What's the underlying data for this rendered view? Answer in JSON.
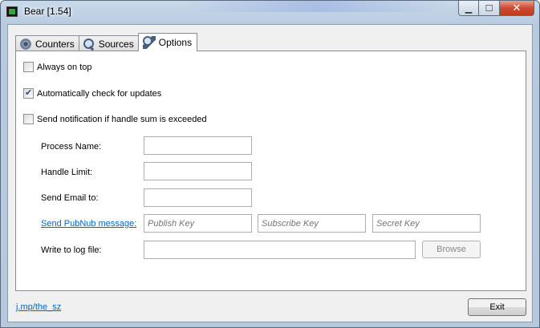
{
  "window": {
    "title": "Bear [1.54]",
    "controls": {
      "minimize": "▁",
      "maximize": "☐",
      "close": "✕"
    }
  },
  "tabs": [
    {
      "label": "Counters",
      "icon": "gear-icon",
      "active": false
    },
    {
      "label": "Sources",
      "icon": "magnifier-icon",
      "active": false
    },
    {
      "label": "Options",
      "icon": "wrench-icon",
      "active": true
    }
  ],
  "options": {
    "always_on_top": {
      "label": "Always on top",
      "checked": false
    },
    "auto_check_updates": {
      "label": "Automatically check for updates",
      "checked": true
    },
    "send_notification": {
      "label": "Send notification if handle sum is exceeded",
      "checked": false
    }
  },
  "fields": {
    "process_name": {
      "label": "Process Name:",
      "value": ""
    },
    "handle_limit": {
      "label": "Handle Limit:",
      "value": ""
    },
    "send_email": {
      "label": "Send Email to:",
      "value": ""
    },
    "pubnub": {
      "link_label": "Send PubNub message:",
      "publish_key_placeholder": "Publish Key",
      "subscribe_key_placeholder": "Subscribe Key",
      "secret_key_placeholder": "Secret Key"
    },
    "log_file": {
      "label": "Write to log file:",
      "value": "",
      "browse_label": "Browse"
    }
  },
  "footer": {
    "link_label": "j.mp/the_sz",
    "exit_label": "Exit"
  },
  "colors": {
    "link": "#0066cc",
    "close_button": "#c2391f"
  }
}
